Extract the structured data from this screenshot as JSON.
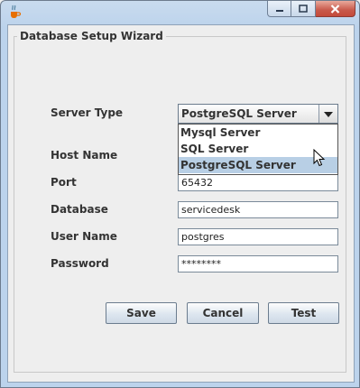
{
  "window": {
    "app_icon": "java-cup-icon",
    "controls": {
      "minimize": "minimize-icon",
      "maximize": "maximize-icon",
      "close": "close-icon"
    }
  },
  "form": {
    "group_title": "Database Setup Wizard",
    "server_type": {
      "label": "Server Type",
      "selected": "PostgreSQL Server",
      "options": [
        "Mysql Server",
        "SQL Server",
        "PostgreSQL Server"
      ],
      "highlighted_option": "PostgreSQL Server"
    },
    "host_name": {
      "label": "Host Name",
      "value": ""
    },
    "port": {
      "label": "Port",
      "value": "65432"
    },
    "database": {
      "label": "Database",
      "value": "servicedesk"
    },
    "user_name": {
      "label": "User Name",
      "value": "postgres"
    },
    "password": {
      "label": "Password",
      "value": "********"
    }
  },
  "buttons": {
    "save": "Save",
    "cancel": "Cancel",
    "test": "Test"
  },
  "colors": {
    "selection": "#b8cfe5",
    "title_bar": "#c9dbee",
    "close_button": "#c8594a"
  }
}
